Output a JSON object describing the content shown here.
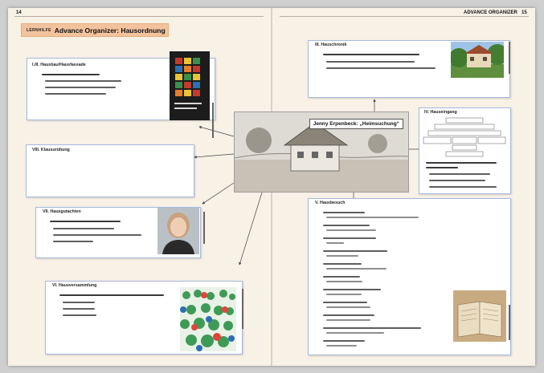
{
  "page": {
    "left_number": "14",
    "right_header": "ADVANCE ORGANIZER",
    "right_number": "15"
  },
  "title": {
    "tag": "LERNHILFE",
    "text": "Advance Organizer: Hausordnung"
  },
  "sections": {
    "s1": {
      "title": "I./II. Hausbau/Hausfassade"
    },
    "s3": {
      "title": "III. Hauschronik"
    },
    "s4": {
      "title": "IV. Hauseingang"
    },
    "s5": {
      "title": "V. Hausbesuch"
    },
    "s6": {
      "title": "VI. Hausversammlung"
    },
    "s7": {
      "title": "VII. Hausgutachten"
    },
    "s8": {
      "title": "VIII. Klausurübung"
    }
  },
  "center": {
    "label": "Jenny Erpenbeck: „Heimsuchung“"
  },
  "colors": {
    "page": "#f7f1e6",
    "box_border": "#a7b9dc",
    "title_bg": "#f3c39d",
    "arrow": "#444444"
  },
  "icons": {
    "book_cover": "book-cover-icon",
    "house_photo": "house-photo-icon",
    "portrait": "portrait-icon",
    "crowd": "crowd-illustration-icon",
    "open_book": "open-book-icon",
    "diagram": "narrative-diagram-icon"
  }
}
